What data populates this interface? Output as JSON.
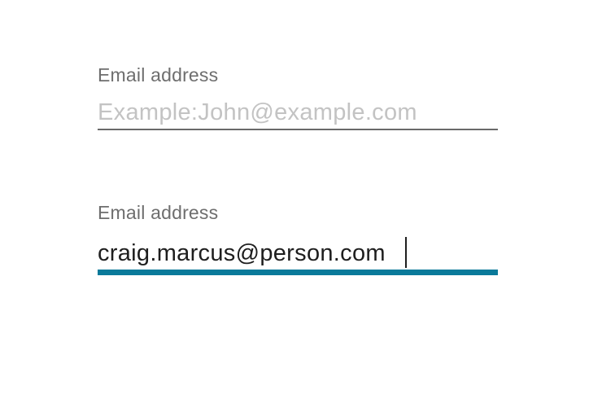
{
  "form": {
    "fields": [
      {
        "label": "Email address",
        "placeholder": "Example:John@example.com",
        "value": ""
      },
      {
        "label": "Email address",
        "placeholder": "",
        "value": "craig.marcus@person.com"
      }
    ]
  },
  "colors": {
    "label": "#6e6e6e",
    "placeholder": "#c3c3c3",
    "text": "#1e1e1e",
    "underline_default": "#6a6a6a",
    "underline_focused": "#0a7a9a"
  }
}
